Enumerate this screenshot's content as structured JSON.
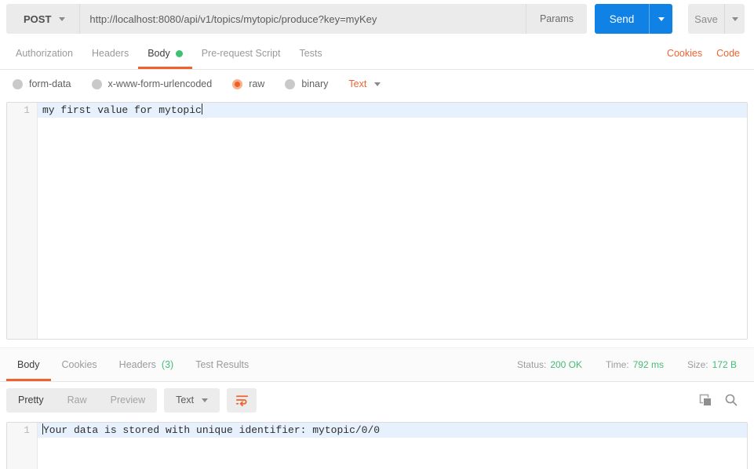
{
  "colors": {
    "accent_orange": "#ef6431",
    "send_blue": "#1082e6",
    "success_green": "#45bb78",
    "active_line_blue": "#e7f1fd",
    "field_gray": "#ebebeb"
  },
  "request_bar": {
    "method": "POST",
    "url": "http://localhost:8080/api/v1/topics/mytopic/produce?key=myKey",
    "params_label": "Params",
    "send_label": "Send",
    "save_label": "Save"
  },
  "request_tabs": {
    "items": [
      {
        "label": "Authorization"
      },
      {
        "label": "Headers"
      },
      {
        "label": "Body"
      },
      {
        "label": "Pre-request Script"
      },
      {
        "label": "Tests"
      }
    ],
    "active": "Body",
    "cookies_label": "Cookies",
    "code_label": "Code"
  },
  "body_type": {
    "options": [
      {
        "label": "form-data"
      },
      {
        "label": "x-www-form-urlencoded"
      },
      {
        "label": "raw"
      },
      {
        "label": "binary"
      }
    ],
    "selected": "raw",
    "format": "Text"
  },
  "request_editor": {
    "line_number": "1",
    "content": "my first value for mytopic"
  },
  "response": {
    "tabs": [
      {
        "label": "Body"
      },
      {
        "label": "Cookies"
      },
      {
        "label": "Headers"
      },
      {
        "label": "Test Results"
      }
    ],
    "active_tab": "Body",
    "headers_count": "(3)",
    "status_label": "Status:",
    "status_value": "200 OK",
    "time_label": "Time:",
    "time_value": "792 ms",
    "size_label": "Size:",
    "size_value": "172 B",
    "view_modes": [
      {
        "label": "Pretty"
      },
      {
        "label": "Raw"
      },
      {
        "label": "Preview"
      }
    ],
    "active_view_mode": "Pretty",
    "format": "Text",
    "editor": {
      "line_number": "1",
      "content": "Your data is stored with unique identifier: mytopic/0/0"
    }
  }
}
